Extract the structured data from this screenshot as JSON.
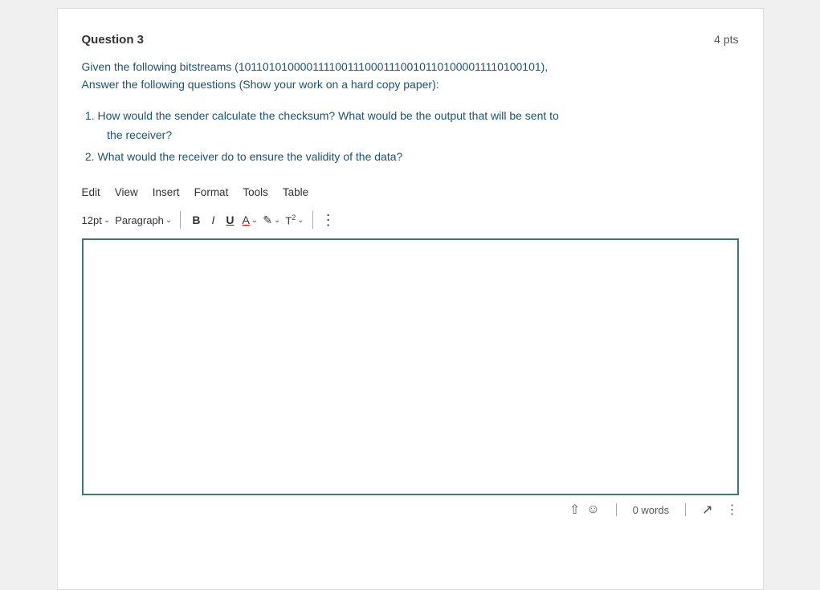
{
  "header": {
    "question_title": "Question 3",
    "pts": "4 pts"
  },
  "question": {
    "intro": "Given the following bitstreams (10110101000011110011100011100101101000011110100101), Answer the following questions (Show your work on a hard copy paper):",
    "items": [
      "How would the sender calculate the checksum? What would be the output that will be sent to the receiver?",
      "What would the receiver do to ensure the validity of the data?"
    ]
  },
  "toolbar": {
    "menu_items": [
      "Edit",
      "View",
      "Insert",
      "Format",
      "Tools",
      "Table"
    ],
    "font_size": "12pt",
    "paragraph": "Paragraph",
    "bold_label": "B",
    "italic_label": "I",
    "underline_label": "U"
  },
  "bottom": {
    "words_label": "0 words"
  }
}
